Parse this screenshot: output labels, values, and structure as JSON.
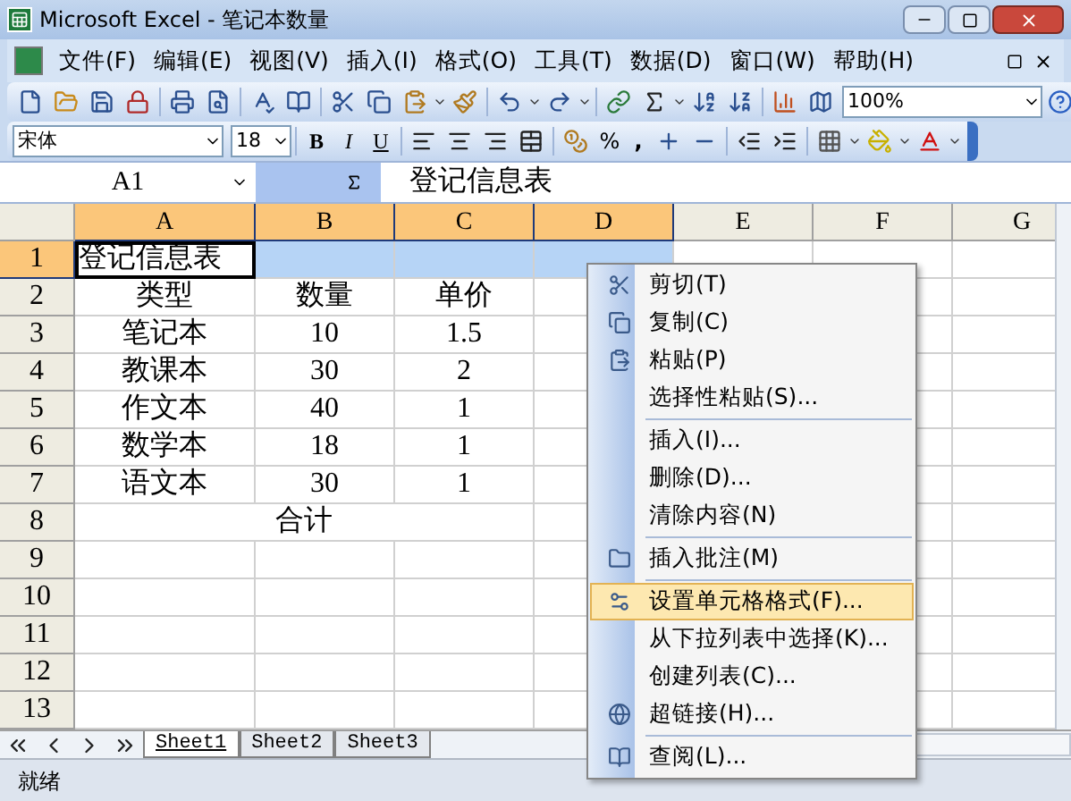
{
  "window": {
    "title": "Microsoft Excel - 笔记本数量"
  },
  "menu_bar": [
    "文件(F)",
    "编辑(E)",
    "视图(V)",
    "插入(I)",
    "格式(O)",
    "工具(T)",
    "数据(D)",
    "窗口(W)",
    "帮助(H)"
  ],
  "standard_toolbar": {
    "zoom": "100%"
  },
  "formatting_toolbar": {
    "font": "宋体",
    "size": "18",
    "style_buttons": [
      "B",
      "I",
      "U"
    ],
    "percent": "%",
    "comma": ","
  },
  "formula_bar": {
    "name_box": "A1",
    "formula": "登记信息表"
  },
  "sheet": {
    "columns": [
      {
        "label": "A",
        "selected": true
      },
      {
        "label": "B",
        "selected": true
      },
      {
        "label": "C",
        "selected": true
      },
      {
        "label": "D",
        "selected": true
      },
      {
        "label": "E",
        "selected": false
      },
      {
        "label": "F",
        "selected": false
      },
      {
        "label": "G",
        "selected": false
      }
    ],
    "rows": [
      {
        "label": "1",
        "selected": true,
        "cells": [
          {
            "text": "登记信息表",
            "active": true,
            "align_left": true
          }
        ]
      },
      {
        "label": "2",
        "selected": false,
        "cells": [
          {
            "text": "类型"
          },
          {
            "text": "数量"
          },
          {
            "text": "单价"
          }
        ]
      },
      {
        "label": "3",
        "selected": false,
        "cells": [
          {
            "text": "笔记本"
          },
          {
            "text": "10"
          },
          {
            "text": "1.5"
          }
        ]
      },
      {
        "label": "4",
        "selected": false,
        "cells": [
          {
            "text": "教课本"
          },
          {
            "text": "30"
          },
          {
            "text": "2"
          }
        ]
      },
      {
        "label": "5",
        "selected": false,
        "cells": [
          {
            "text": "作文本"
          },
          {
            "text": "40"
          },
          {
            "text": "1"
          }
        ]
      },
      {
        "label": "6",
        "selected": false,
        "cells": [
          {
            "text": "数学本"
          },
          {
            "text": "18"
          },
          {
            "text": "1"
          }
        ]
      },
      {
        "label": "7",
        "selected": false,
        "cells": [
          {
            "text": "语文本"
          },
          {
            "text": "30"
          },
          {
            "text": "1"
          }
        ]
      },
      {
        "label": "8",
        "selected": false,
        "cells": [
          {
            "text": "合计",
            "merged": true
          },
          null,
          null
        ]
      },
      {
        "label": "9",
        "selected": false
      },
      {
        "label": "10",
        "selected": false
      },
      {
        "label": "11",
        "selected": false
      },
      {
        "label": "12",
        "selected": false
      },
      {
        "label": "13",
        "selected": false
      }
    ]
  },
  "context_menu": [
    {
      "kind": "item",
      "label": "剪切(T)",
      "selected": false
    },
    {
      "kind": "item",
      "label": "复制(C)",
      "selected": false
    },
    {
      "kind": "item",
      "label": "粘贴(P)",
      "selected": false
    },
    {
      "kind": "item",
      "label": "选择性粘贴(S)...",
      "selected": false
    },
    {
      "kind": "separator"
    },
    {
      "kind": "item",
      "label": "插入(I)...",
      "selected": false
    },
    {
      "kind": "item",
      "label": "删除(D)...",
      "selected": false
    },
    {
      "kind": "item",
      "label": "清除内容(N)",
      "selected": false
    },
    {
      "kind": "separator"
    },
    {
      "kind": "item",
      "label": "插入批注(M)",
      "selected": false
    },
    {
      "kind": "separator"
    },
    {
      "kind": "item",
      "label": "设置单元格格式(F)...",
      "selected": true
    },
    {
      "kind": "item",
      "label": "从下拉列表中选择(K)...",
      "selected": false
    },
    {
      "kind": "item",
      "label": "创建列表(C)...",
      "selected": false
    },
    {
      "kind": "item",
      "label": "超链接(H)...",
      "selected": false
    },
    {
      "kind": "separator"
    },
    {
      "kind": "item",
      "label": "查阅(L)...",
      "selected": false
    }
  ],
  "sheet_tabs": [
    {
      "label": "Sheet1",
      "selected": true
    },
    {
      "label": "Sheet2",
      "selected": false
    },
    {
      "label": "Sheet3",
      "selected": false
    }
  ],
  "status_bar": {
    "text": "就绪"
  }
}
